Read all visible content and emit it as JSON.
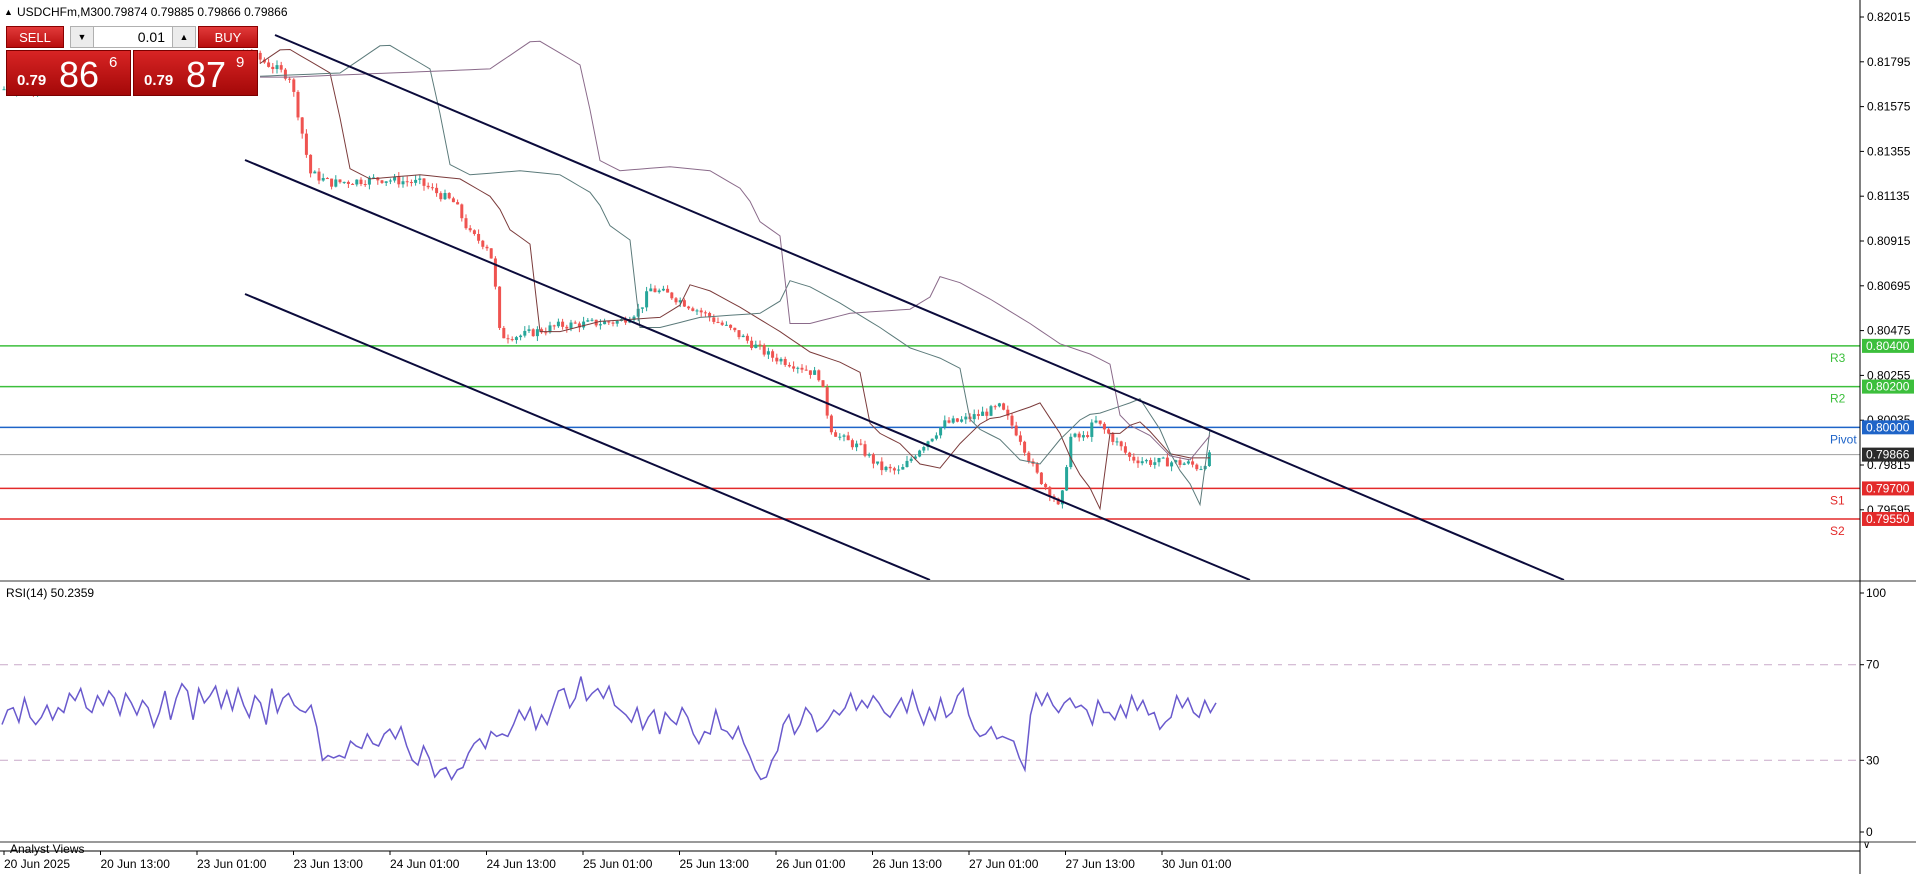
{
  "header": {
    "symbol": "USDCHFm,M30",
    "ohlc": "0.79874 0.79885 0.79866 0.79866"
  },
  "trade": {
    "sell_label": "SELL",
    "buy_label": "BUY",
    "lot": "0.01",
    "sell_price": {
      "prefix": "0.79",
      "big": "86",
      "sup": "6"
    },
    "buy_price": {
      "prefix": "0.79",
      "big": "87",
      "sup": "9"
    }
  },
  "price_axis": {
    "ticks": [
      "0.82015",
      "0.81795",
      "0.81575",
      "0.81355",
      "0.81135",
      "0.80915",
      "0.80695",
      "0.80475",
      "0.80255",
      "0.80035",
      "0.79815",
      "0.79595"
    ],
    "current_price": "0.79866"
  },
  "levels": [
    {
      "value": 0.804,
      "label": "0.80400",
      "tag": "R3",
      "color": "#3cbf3c"
    },
    {
      "value": 0.802,
      "label": "0.80200",
      "tag": "R2",
      "color": "#3cbf3c"
    },
    {
      "value": 0.8,
      "label": "0.80000",
      "tag": "Pivot",
      "color": "#1e64c8"
    },
    {
      "value": 0.797,
      "label": "0.79700",
      "tag": "S1",
      "color": "#e32a2a"
    },
    {
      "value": 0.7955,
      "label": "0.79550",
      "tag": "S2",
      "color": "#e32a2a"
    }
  ],
  "rsi": {
    "label": "RSI(14) 50.2359",
    "ticks": [
      "100",
      "70",
      "30",
      "0"
    ],
    "values": [
      45,
      51,
      52,
      46,
      56,
      48,
      45,
      48,
      53,
      47,
      52,
      50,
      58,
      55,
      60,
      52,
      50,
      57,
      53,
      59,
      56,
      49,
      58,
      54,
      49,
      55,
      52,
      44,
      50,
      59,
      47,
      56,
      62,
      59,
      47,
      60,
      54,
      57,
      61,
      52,
      59,
      51,
      60,
      53,
      48,
      57,
      54,
      45,
      60,
      50,
      56,
      58,
      53,
      51,
      50,
      53,
      44,
      30,
      32,
      31,
      32,
      31,
      38,
      36,
      35,
      41,
      37,
      36,
      41,
      43,
      39,
      44,
      36,
      30,
      28,
      36,
      31,
      23,
      26,
      27,
      22,
      26,
      27,
      33,
      37,
      39,
      35,
      42,
      40,
      41,
      40,
      45,
      51,
      47,
      52,
      43,
      49,
      45,
      52,
      59,
      60,
      52,
      56,
      65,
      55,
      58,
      60,
      56,
      61,
      53,
      51,
      49,
      46,
      52,
      43,
      48,
      51,
      41,
      50,
      47,
      45,
      52,
      48,
      41,
      37,
      42,
      41,
      51,
      43,
      42,
      39,
      44,
      37,
      32,
      26,
      22,
      23,
      30,
      34,
      45,
      49,
      41,
      45,
      52,
      49,
      42,
      44,
      47,
      51,
      49,
      52,
      58,
      51,
      55,
      52,
      57,
      54,
      50,
      48,
      52,
      56,
      50,
      59,
      51,
      45,
      52,
      47,
      56,
      48,
      50,
      57,
      60,
      49,
      43,
      40,
      41,
      44,
      39,
      40,
      39,
      38,
      31,
      26,
      49,
      58,
      53,
      58,
      53,
      50,
      54,
      56,
      52,
      53,
      51,
      45,
      55,
      50,
      50,
      47,
      53,
      48,
      57,
      51,
      55,
      49,
      50,
      43,
      46,
      48,
      57,
      52,
      56,
      50,
      48,
      55,
      50,
      54
    ]
  },
  "time_axis": [
    "20 Jun 2025",
    "20 Jun 13:00",
    "23 Jun 01:00",
    "23 Jun 13:00",
    "24 Jun 01:00",
    "24 Jun 13:00",
    "25 Jun 01:00",
    "25 Jun 13:00",
    "26 Jun 01:00",
    "26 Jun 13:00",
    "27 Jun 01:00",
    "27 Jun 13:00",
    "30 Jun 01:00"
  ],
  "bottom_tab": "Analyst Views",
  "colors": {
    "bull": "#26a69a",
    "bear": "#ef5350",
    "rsi": "#6a5acd",
    "channel": "#0b0b3b"
  }
}
